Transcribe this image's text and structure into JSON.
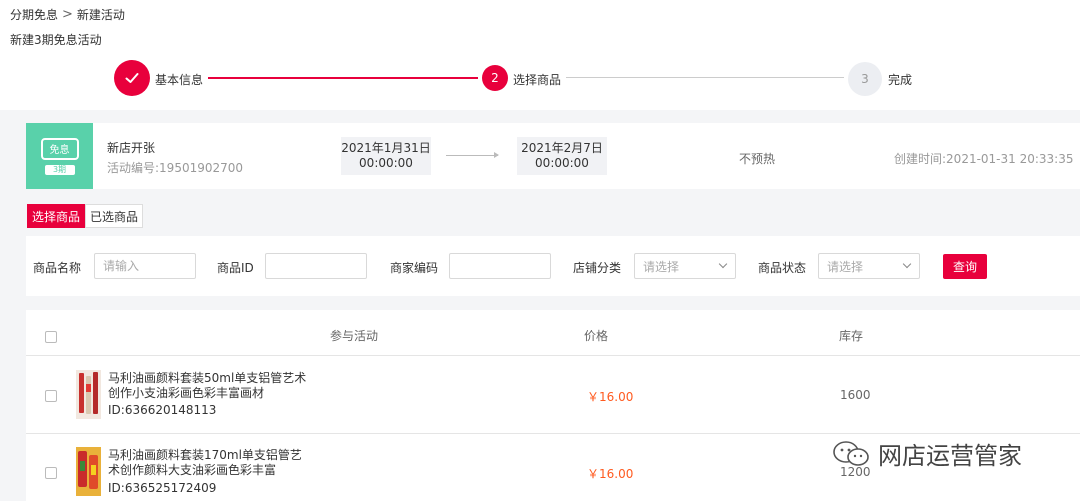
{
  "breadcrumb": {
    "parent": "分期免息",
    "current": "新建活动"
  },
  "page_title": "新建3期免息活动",
  "steps": [
    {
      "label": "基本信息",
      "number": "1",
      "state": "done"
    },
    {
      "label": "选择商品",
      "number": "2",
      "state": "active"
    },
    {
      "label": "完成",
      "number": "3",
      "state": "pending"
    }
  ],
  "activity": {
    "badge_text": "免息",
    "badge_tag": "3期",
    "name": "新店开张",
    "code": "活动编号:19501902700",
    "start_date": "2021年1月31日",
    "start_time": "00:00:00",
    "end_date": "2021年2月7日",
    "end_time": "00:00:00",
    "preheat": "不预热",
    "created": "创建时间:2021-01-31 20:33:35"
  },
  "tabs": [
    {
      "label": "选择商品",
      "active": true
    },
    {
      "label": "已选商品",
      "active": false
    }
  ],
  "filters": {
    "name_label": "商品名称",
    "name_placeholder": "请输入",
    "id_label": "商品ID",
    "id_value": "",
    "merchant_label": "商家编码",
    "merchant_value": "",
    "category_label": "店铺分类",
    "category_value": "请选择",
    "status_label": "商品状态",
    "status_value": "请选择",
    "query_label": "查询"
  },
  "table": {
    "headers": {
      "activity": "参与活动",
      "price": "价格",
      "stock": "库存"
    },
    "rows": [
      {
        "title": "马利油画颜料套装50ml单支铝管艺术创作小支油彩画色彩丰富画材",
        "id": "ID:636620148113",
        "price": "￥16.00",
        "stock": "1600"
      },
      {
        "title": "马利油画颜料套装170ml单支铝管艺术创作颜料大支油彩画色彩丰富",
        "id": "ID:636525172409",
        "price": "￥16.00",
        "stock": "1200"
      }
    ]
  },
  "watermark": "网店运营管家",
  "colors": {
    "accent": "#e8003c",
    "badge": "#59d1aa",
    "price": "#ff5a1f"
  }
}
